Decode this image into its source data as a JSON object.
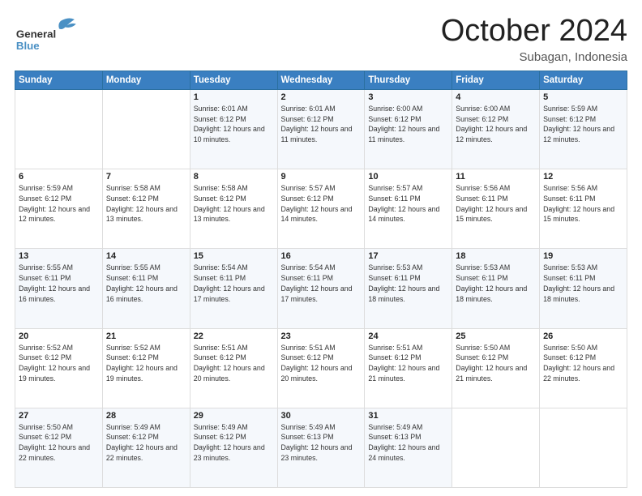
{
  "header": {
    "logo_general": "General",
    "logo_blue": "Blue",
    "month_title": "October 2024",
    "location": "Subagan, Indonesia"
  },
  "days_of_week": [
    "Sunday",
    "Monday",
    "Tuesday",
    "Wednesday",
    "Thursday",
    "Friday",
    "Saturday"
  ],
  "weeks": [
    [
      {
        "day": "",
        "info": ""
      },
      {
        "day": "",
        "info": ""
      },
      {
        "day": "1",
        "info": "Sunrise: 6:01 AM\nSunset: 6:12 PM\nDaylight: 12 hours and 10 minutes."
      },
      {
        "day": "2",
        "info": "Sunrise: 6:01 AM\nSunset: 6:12 PM\nDaylight: 12 hours and 11 minutes."
      },
      {
        "day": "3",
        "info": "Sunrise: 6:00 AM\nSunset: 6:12 PM\nDaylight: 12 hours and 11 minutes."
      },
      {
        "day": "4",
        "info": "Sunrise: 6:00 AM\nSunset: 6:12 PM\nDaylight: 12 hours and 12 minutes."
      },
      {
        "day": "5",
        "info": "Sunrise: 5:59 AM\nSunset: 6:12 PM\nDaylight: 12 hours and 12 minutes."
      }
    ],
    [
      {
        "day": "6",
        "info": "Sunrise: 5:59 AM\nSunset: 6:12 PM\nDaylight: 12 hours and 12 minutes."
      },
      {
        "day": "7",
        "info": "Sunrise: 5:58 AM\nSunset: 6:12 PM\nDaylight: 12 hours and 13 minutes."
      },
      {
        "day": "8",
        "info": "Sunrise: 5:58 AM\nSunset: 6:12 PM\nDaylight: 12 hours and 13 minutes."
      },
      {
        "day": "9",
        "info": "Sunrise: 5:57 AM\nSunset: 6:12 PM\nDaylight: 12 hours and 14 minutes."
      },
      {
        "day": "10",
        "info": "Sunrise: 5:57 AM\nSunset: 6:11 PM\nDaylight: 12 hours and 14 minutes."
      },
      {
        "day": "11",
        "info": "Sunrise: 5:56 AM\nSunset: 6:11 PM\nDaylight: 12 hours and 15 minutes."
      },
      {
        "day": "12",
        "info": "Sunrise: 5:56 AM\nSunset: 6:11 PM\nDaylight: 12 hours and 15 minutes."
      }
    ],
    [
      {
        "day": "13",
        "info": "Sunrise: 5:55 AM\nSunset: 6:11 PM\nDaylight: 12 hours and 16 minutes."
      },
      {
        "day": "14",
        "info": "Sunrise: 5:55 AM\nSunset: 6:11 PM\nDaylight: 12 hours and 16 minutes."
      },
      {
        "day": "15",
        "info": "Sunrise: 5:54 AM\nSunset: 6:11 PM\nDaylight: 12 hours and 17 minutes."
      },
      {
        "day": "16",
        "info": "Sunrise: 5:54 AM\nSunset: 6:11 PM\nDaylight: 12 hours and 17 minutes."
      },
      {
        "day": "17",
        "info": "Sunrise: 5:53 AM\nSunset: 6:11 PM\nDaylight: 12 hours and 18 minutes."
      },
      {
        "day": "18",
        "info": "Sunrise: 5:53 AM\nSunset: 6:11 PM\nDaylight: 12 hours and 18 minutes."
      },
      {
        "day": "19",
        "info": "Sunrise: 5:53 AM\nSunset: 6:11 PM\nDaylight: 12 hours and 18 minutes."
      }
    ],
    [
      {
        "day": "20",
        "info": "Sunrise: 5:52 AM\nSunset: 6:12 PM\nDaylight: 12 hours and 19 minutes."
      },
      {
        "day": "21",
        "info": "Sunrise: 5:52 AM\nSunset: 6:12 PM\nDaylight: 12 hours and 19 minutes."
      },
      {
        "day": "22",
        "info": "Sunrise: 5:51 AM\nSunset: 6:12 PM\nDaylight: 12 hours and 20 minutes."
      },
      {
        "day": "23",
        "info": "Sunrise: 5:51 AM\nSunset: 6:12 PM\nDaylight: 12 hours and 20 minutes."
      },
      {
        "day": "24",
        "info": "Sunrise: 5:51 AM\nSunset: 6:12 PM\nDaylight: 12 hours and 21 minutes."
      },
      {
        "day": "25",
        "info": "Sunrise: 5:50 AM\nSunset: 6:12 PM\nDaylight: 12 hours and 21 minutes."
      },
      {
        "day": "26",
        "info": "Sunrise: 5:50 AM\nSunset: 6:12 PM\nDaylight: 12 hours and 22 minutes."
      }
    ],
    [
      {
        "day": "27",
        "info": "Sunrise: 5:50 AM\nSunset: 6:12 PM\nDaylight: 12 hours and 22 minutes."
      },
      {
        "day": "28",
        "info": "Sunrise: 5:49 AM\nSunset: 6:12 PM\nDaylight: 12 hours and 22 minutes."
      },
      {
        "day": "29",
        "info": "Sunrise: 5:49 AM\nSunset: 6:12 PM\nDaylight: 12 hours and 23 minutes."
      },
      {
        "day": "30",
        "info": "Sunrise: 5:49 AM\nSunset: 6:13 PM\nDaylight: 12 hours and 23 minutes."
      },
      {
        "day": "31",
        "info": "Sunrise: 5:49 AM\nSunset: 6:13 PM\nDaylight: 12 hours and 24 minutes."
      },
      {
        "day": "",
        "info": ""
      },
      {
        "day": "",
        "info": ""
      }
    ]
  ]
}
